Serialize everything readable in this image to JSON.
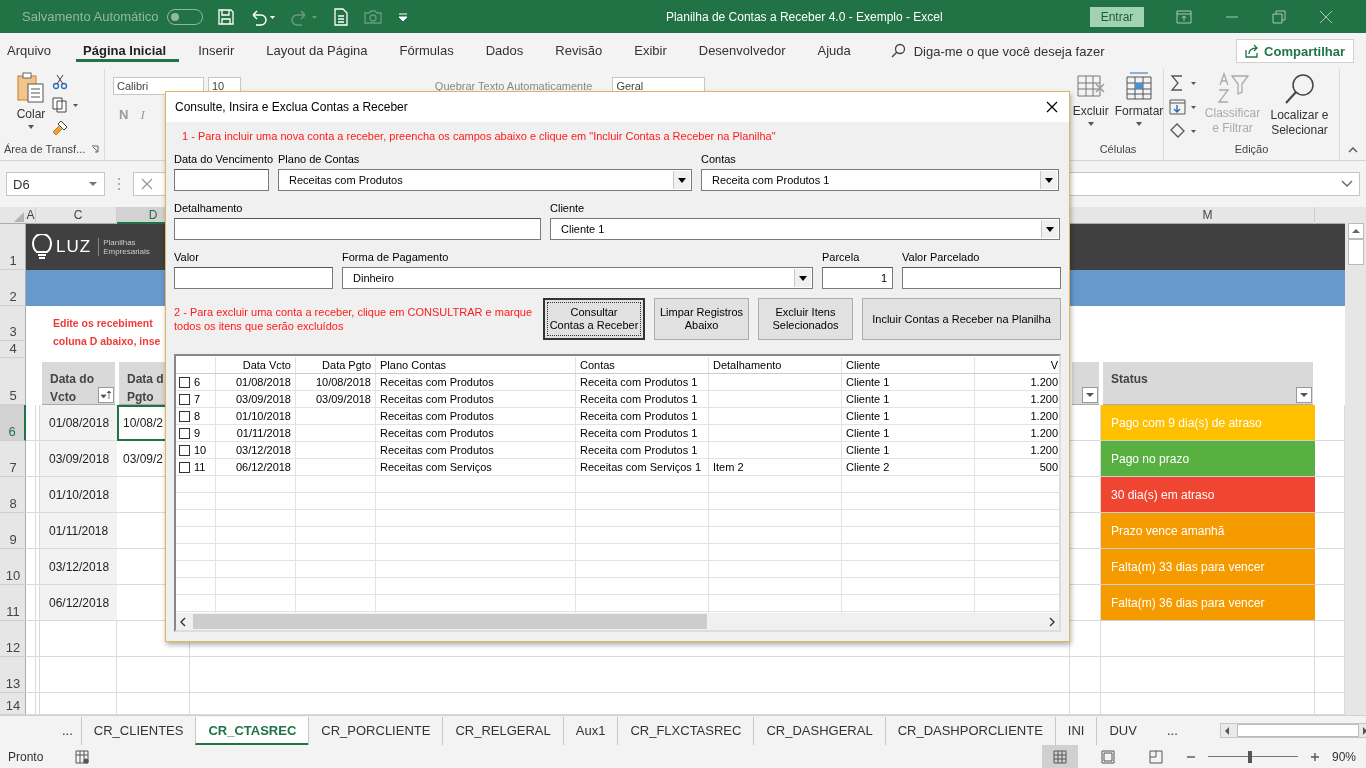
{
  "title_bar": {
    "autosave": {
      "label": "Salvamento Automático",
      "on": false
    },
    "title": "Planilha de Contas a Receber 4.0 - Exemplo  -  Excel",
    "sign_in": "Entrar"
  },
  "ribbon_tabs": [
    {
      "label": "Arquivo",
      "selected": false
    },
    {
      "label": "Página Inicial",
      "selected": true
    },
    {
      "label": "Inserir",
      "selected": false
    },
    {
      "label": "Layout da Página",
      "selected": false
    },
    {
      "label": "Fórmulas",
      "selected": false
    },
    {
      "label": "Dados",
      "selected": false
    },
    {
      "label": "Revisão",
      "selected": false
    },
    {
      "label": "Exibir",
      "selected": false
    },
    {
      "label": "Desenvolvedor",
      "selected": false
    },
    {
      "label": "Ajuda",
      "selected": false
    }
  ],
  "tell_me": {
    "placeholder": "Diga-me o que você deseja fazer"
  },
  "share": "Compartilhar",
  "ribbon": {
    "clipboard": {
      "paste": "Colar",
      "label": "Área de Transf..."
    },
    "font": {
      "name": "Calibri",
      "size": "10",
      "bold": "N",
      "italic": "I"
    },
    "wrap_text": "Quebrar Texto Automaticamente",
    "number_format": "Geral",
    "cells": {
      "delete": "Excluir",
      "format": "Formatar",
      "label": "Células"
    },
    "editing": {
      "sort": {
        "label": "Classificar e Filtrar",
        "disabled": true
      },
      "find": "Localizar e Selecionar",
      "label": "Edição"
    }
  },
  "formula_bar": {
    "name_box": "D6"
  },
  "sheet": {
    "columns": [
      {
        "label": "A",
        "selected": false
      },
      {
        "label": "C",
        "selected": false
      },
      {
        "label": "D",
        "selected": true
      },
      {
        "label": "M",
        "selected": false
      }
    ],
    "row_numbers": [
      {
        "label": "1",
        "selected": false
      },
      {
        "label": "2",
        "selected": false
      },
      {
        "label": "3",
        "selected": false
      },
      {
        "label": "4",
        "selected": false
      },
      {
        "label": "5",
        "selected": false
      },
      {
        "label": "6",
        "selected": true
      },
      {
        "label": "7",
        "selected": false
      },
      {
        "label": "8",
        "selected": false
      },
      {
        "label": "9",
        "selected": false
      },
      {
        "label": "10",
        "selected": false
      },
      {
        "label": "11",
        "selected": false
      },
      {
        "label": "12",
        "selected": false
      },
      {
        "label": "13",
        "selected": false
      },
      {
        "label": "14",
        "selected": false
      }
    ],
    "logo": {
      "name": "LUZ",
      "tagline": "Planilhas Empresariais"
    },
    "note": [
      "Edite os recebiment",
      "coluna D abaixo, inse"
    ],
    "headers": {
      "vcto": [
        "Data do",
        "Vcto"
      ],
      "pgto": [
        "Data d",
        "Pgto"
      ],
      "status": [
        "Status"
      ]
    },
    "rows": [
      {
        "vcto": "01/08/2018",
        "pgto": "10/08/2",
        "status": "Pago com 9 dia(s) de atraso",
        "color": "#ffc000"
      },
      {
        "vcto": "03/09/2018",
        "pgto": "03/09/2",
        "status": "Pago no prazo",
        "color": "#57b040"
      },
      {
        "vcto": "01/10/2018",
        "status": "30 dia(s) em atraso",
        "color": "#f04530"
      },
      {
        "vcto": "01/11/2018",
        "status": "Prazo vence amanhã",
        "color": "#f59b00"
      },
      {
        "vcto": "03/12/2018",
        "status": "Falta(m) 33 dias para vencer",
        "color": "#f59b00"
      },
      {
        "vcto": "06/12/2018",
        "status": "Falta(m) 36 dias para vencer",
        "color": "#f59b00"
      }
    ]
  },
  "dialog": {
    "title": "Consulte, Insira e Exclua Contas a Receber",
    "instruction_1": "1 - Para incluir uma nova conta a receber, preencha os campos abaixo e clique em \"Incluir Contas a Receber na Planilha\"",
    "field_rows": [
      [
        {
          "label": "Data do Vencimento",
          "kind": "text"
        },
        {
          "label": "Plano de Contas",
          "kind": "combo",
          "value": "Receitas com Produtos"
        },
        {
          "label": "Contas",
          "kind": "combo",
          "value": "Receita com Produtos 1"
        }
      ],
      [
        {
          "label": "Detalhamento",
          "kind": "text"
        },
        {
          "label": "Cliente",
          "kind": "combo",
          "value": "Cliente 1"
        }
      ],
      [
        {
          "label": "Valor",
          "kind": "text"
        },
        {
          "label": "Forma de Pagamento",
          "kind": "combo",
          "value": "Dinheiro"
        },
        {
          "label": "Parcela",
          "kind": "number",
          "value": "1"
        },
        {
          "label": "Valor Parcelado",
          "kind": "text"
        }
      ]
    ],
    "instruction_2": "2 - Para excluir uma conta a receber, clique em CONSULTRAR e marque todos os itens que serão excluídos",
    "buttons": [
      {
        "label": "Consultar\nContas a Receber",
        "default": true
      },
      {
        "label": "Limpar Registros\nAbaixo",
        "default": false
      },
      {
        "label": "Excluir Itens\nSelecionados",
        "default": false
      },
      {
        "label": "Incluir Contas a Receber na Planilha",
        "default": false
      }
    ],
    "list": {
      "columns": [
        "Data Vcto",
        "Data Pgto",
        "Plano Contas",
        "Contas",
        "Detalhamento",
        "Cliente",
        "V"
      ],
      "rows": [
        {
          "checked": false,
          "number": "6",
          "vcto": "01/08/2018",
          "pgto": "10/08/2018",
          "plan": "Receitas com Produtos",
          "account": "Receita com Produtos 1",
          "client": "Cliente 1",
          "value": "1.200"
        },
        {
          "checked": false,
          "number": "7",
          "vcto": "03/09/2018",
          "pgto": "03/09/2018",
          "plan": "Receitas com Produtos",
          "account": "Receita com Produtos 1",
          "client": "Cliente 1",
          "value": "1.200"
        },
        {
          "checked": false,
          "number": "8",
          "vcto": "01/10/2018",
          "plan": "Receitas com Produtos",
          "account": "Receita com Produtos 1",
          "client": "Cliente 1",
          "value": "1.200"
        },
        {
          "checked": false,
          "number": "9",
          "vcto": "01/11/2018",
          "plan": "Receitas com Produtos",
          "account": "Receita com Produtos 1",
          "client": "Cliente 1",
          "value": "1.200"
        },
        {
          "checked": false,
          "number": "10",
          "vcto": "03/12/2018",
          "plan": "Receitas com Produtos",
          "account": "Receita com Produtos 1",
          "client": "Cliente 1",
          "value": "1.200"
        },
        {
          "checked": false,
          "number": "11",
          "vcto": "06/12/2018",
          "plan": "Receitas com Serviços",
          "account": "Receitas com Serviços 1",
          "detail": "Item 2",
          "client": "Cliente 2",
          "value": "500"
        }
      ]
    }
  },
  "sheet_tabs": [
    {
      "label": "CR_CLIENTES",
      "selected": false
    },
    {
      "label": "CR_CTASREC",
      "selected": true
    },
    {
      "label": "CR_PORCLIENTE",
      "selected": false
    },
    {
      "label": "CR_RELGERAL",
      "selected": false
    },
    {
      "label": "Aux1",
      "selected": false
    },
    {
      "label": "CR_FLXCTASREC",
      "selected": false
    },
    {
      "label": "CR_DASHGERAL",
      "selected": false
    },
    {
      "label": "CR_DASHPORCLIENTE",
      "selected": false
    },
    {
      "label": "INI",
      "selected": false
    },
    {
      "label": "DUV",
      "selected": false
    }
  ],
  "sheet_nav": {
    "more_left": "...",
    "more_right": "..."
  },
  "status_bar": {
    "status": "Pronto",
    "zoom": {
      "level": 0.47,
      "reading": "90%"
    }
  }
}
